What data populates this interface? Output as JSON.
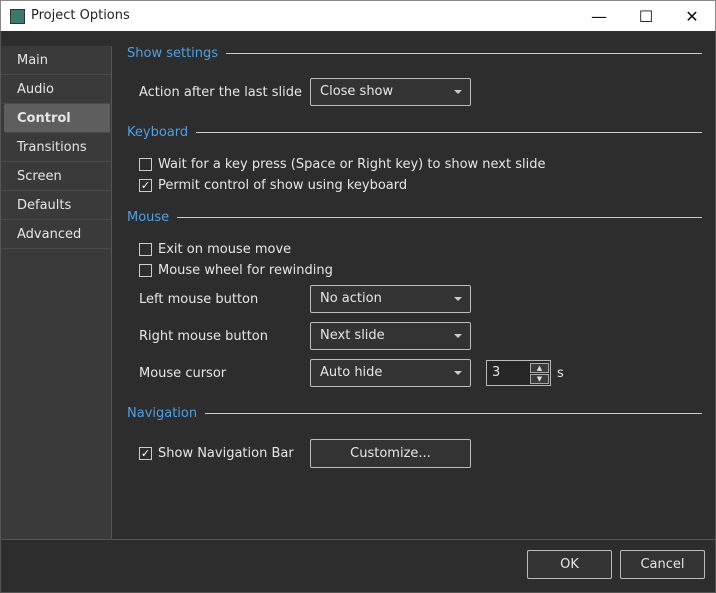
{
  "window": {
    "title": "Project Options",
    "minimize": "—",
    "maximize": "☐",
    "close": "✕"
  },
  "sidebar": {
    "items": [
      {
        "label": "Main"
      },
      {
        "label": "Audio"
      },
      {
        "label": "Control",
        "selected": true
      },
      {
        "label": "Transitions"
      },
      {
        "label": "Screen"
      },
      {
        "label": "Defaults"
      },
      {
        "label": "Advanced"
      }
    ]
  },
  "show_settings": {
    "title": "Show settings",
    "action_label": "Action after the last slide",
    "action_value": "Close show"
  },
  "keyboard": {
    "title": "Keyboard",
    "wait_key": {
      "label": "Wait for a key press (Space or Right key) to show next slide",
      "checked": false
    },
    "permit": {
      "label": "Permit control of show using keyboard",
      "checked": true
    }
  },
  "mouse": {
    "title": "Mouse",
    "exit_move": {
      "label": "Exit on mouse move",
      "checked": false
    },
    "wheel": {
      "label": "Mouse wheel for rewinding",
      "checked": false
    },
    "left_label": "Left mouse button",
    "left_value": "No action",
    "right_label": "Right mouse button",
    "right_value": "Next slide",
    "cursor_label": "Mouse cursor",
    "cursor_value": "Auto hide",
    "cursor_seconds": "3",
    "seconds_unit": "s"
  },
  "navigation": {
    "title": "Navigation",
    "show_bar": {
      "label": "Show Navigation Bar",
      "checked": true
    },
    "customize": "Customize..."
  },
  "footer": {
    "ok": "OK",
    "cancel": "Cancel"
  }
}
